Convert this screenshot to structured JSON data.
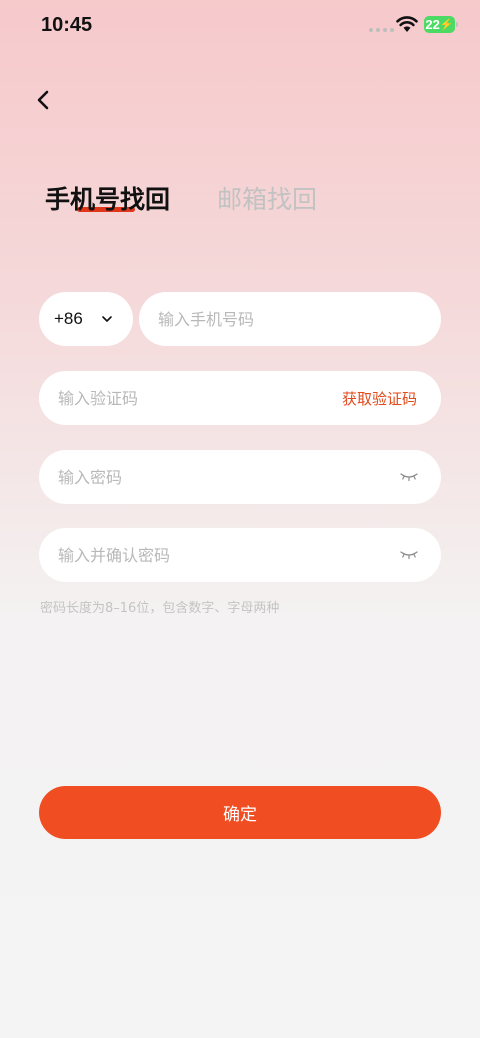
{
  "status_bar": {
    "time": "10:45",
    "battery": "22",
    "icons": [
      "signal-dots-icon",
      "wifi-icon",
      "battery-icon"
    ]
  },
  "nav": {
    "back_icon": "chevron-left-icon"
  },
  "tabs": [
    {
      "label": "手机号找回",
      "active": true
    },
    {
      "label": "邮箱找回",
      "active": false
    }
  ],
  "form": {
    "country_code": "+86",
    "phone_placeholder": "输入手机号码",
    "code_placeholder": "输入验证码",
    "get_code_label": "获取验证码",
    "password_placeholder": "输入密码",
    "confirm_password_placeholder": "输入并确认密码",
    "password_hint": "密码长度为8–16位，包含数字、字母两种"
  },
  "confirm_label": "确定",
  "colors": {
    "accent": "#f04e22",
    "tab_indicator": "#e0371a",
    "link": "#e04a1c"
  }
}
